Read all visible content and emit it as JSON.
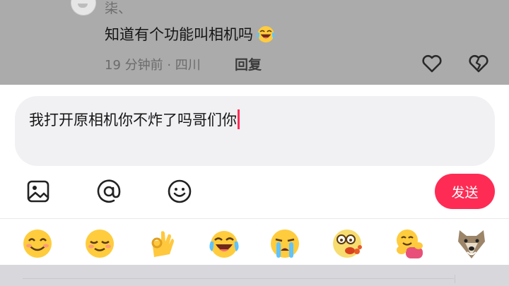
{
  "comment": {
    "username": "柒、",
    "text": "知道有个功能叫相机吗",
    "inline_emoji": "laughing-crying-emoji",
    "meta": "19 分钟前 · 四川",
    "reply_label": "回复"
  },
  "composer": {
    "input_value": "我打开原相机你不炸了吗哥们你",
    "send_label": "发送",
    "tools": [
      "image-icon",
      "mention-icon",
      "emoji-icon"
    ]
  },
  "emoji_bar": [
    "smiling-emoji",
    "relieved-emoji",
    "ok-hand-emoji",
    "laughing-crying-emoji",
    "loudly-crying-emoji",
    "vomiting-emoji",
    "hugging-emoji",
    "dog-face-emoji"
  ],
  "colors": {
    "accent": "#fe2c55",
    "dim_overlay": "#ababab",
    "input_bg": "#f1f0f3"
  }
}
